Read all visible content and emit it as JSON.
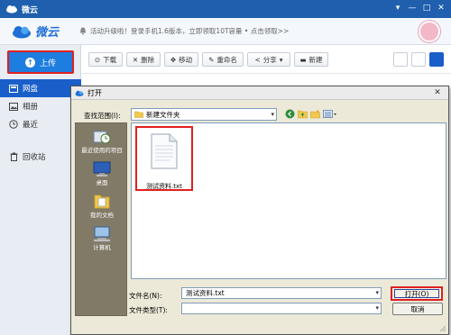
{
  "app": {
    "title": "微云",
    "logo_text": "微云",
    "notice": "活动升级啦！登录手机1.6版本，立即领取10T容量 • 点击领取>>",
    "window_controls": [
      "▾",
      "—",
      "□",
      "✕"
    ]
  },
  "sidebar": {
    "upload_label": "上传",
    "items": [
      {
        "label": "网盘",
        "icon": "drive-icon",
        "active": true
      },
      {
        "label": "相册",
        "icon": "photo-icon",
        "active": false
      },
      {
        "label": "最近",
        "icon": "clock-icon",
        "active": false
      },
      {
        "label": "回收站",
        "icon": "trash-icon",
        "active": false
      }
    ]
  },
  "toolbar": {
    "download": "下载",
    "delete": "删除",
    "move": "移动",
    "rename": "重命名",
    "share": "分享",
    "new": "新建"
  },
  "dialog": {
    "title": "打开",
    "look_in_label": "查找范围(I):",
    "look_in_value": "新建文件夹",
    "places": [
      "最近使用的项目",
      "桌面",
      "我的文档",
      "计算机"
    ],
    "files": [
      {
        "name": "测试资料.txt"
      }
    ],
    "file_name_label": "文件名(N):",
    "file_name_value": "测试资料.txt",
    "file_type_label": "文件类型(T):",
    "open_label": "打开(O)",
    "cancel_label": "取消"
  },
  "colors": {
    "titlebar": "#1f5fae",
    "accent": "#1a5fc9",
    "highlight": "#e02020"
  }
}
